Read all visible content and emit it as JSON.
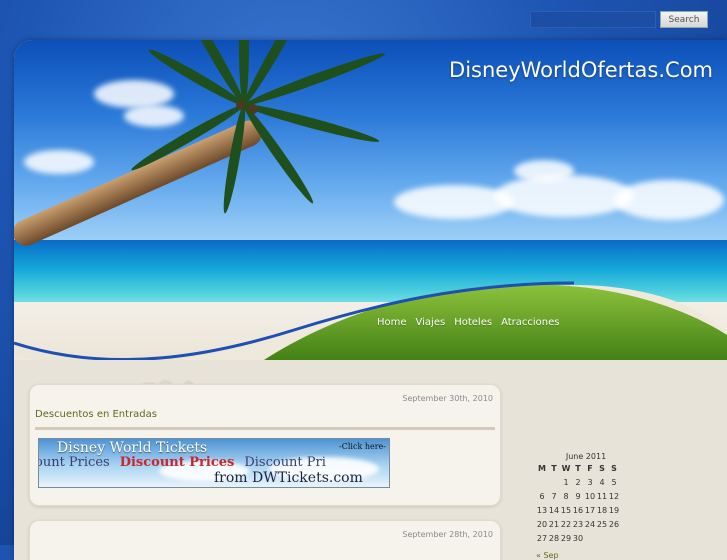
{
  "search": {
    "placeholder": "",
    "value": "",
    "button_label": "Search"
  },
  "header": {
    "site_title": "DisneyWorldOfertas.Com",
    "nav": [
      "Home",
      "Viajes",
      "Hoteles",
      "Atracciones"
    ]
  },
  "posts": [
    {
      "date": "September 30th, 2010",
      "title": "Descuentos en Entradas",
      "banner": {
        "title": "Disney World Tickets",
        "click": "-Click here-",
        "line_parts": [
          "ount Prices",
          "Discount Prices",
          "Discount Pri"
        ],
        "from": "from DWTickets.com"
      }
    },
    {
      "date": "September 28th, 2010"
    }
  ],
  "calendar": {
    "caption": "June 2011",
    "headers": [
      "M",
      "T",
      "W",
      "T",
      "F",
      "S",
      "S"
    ],
    "rows": [
      [
        "",
        "",
        "1",
        "2",
        "3",
        "4",
        "5"
      ],
      [
        "6",
        "7",
        "8",
        "9",
        "10",
        "11",
        "12"
      ],
      [
        "13",
        "14",
        "15",
        "16",
        "17",
        "18",
        "19"
      ],
      [
        "20",
        "21",
        "22",
        "23",
        "24",
        "25",
        "26"
      ],
      [
        "27",
        "28",
        "29",
        "30",
        "",
        "",
        ""
      ]
    ],
    "prev_link": "« Sep"
  },
  "colors": {
    "title_green": "#5c6b1c",
    "frame_blue": "#1e56b4",
    "accent_red": "#c8262a"
  }
}
